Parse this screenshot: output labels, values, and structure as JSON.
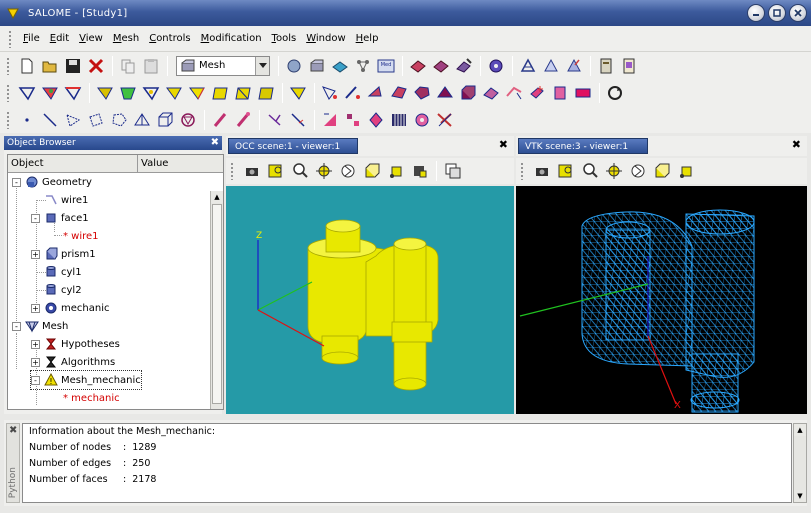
{
  "window": {
    "title": "SALOME - [Study1]"
  },
  "menu": [
    {
      "label": "File",
      "mnemonic": "F",
      "rest": "ile"
    },
    {
      "label": "Edit",
      "mnemonic": "E",
      "rest": "dit"
    },
    {
      "label": "View",
      "mnemonic": "V",
      "rest": "iew"
    },
    {
      "label": "Mesh",
      "mnemonic": "M",
      "rest": "esh"
    },
    {
      "label": "Controls",
      "mnemonic": "C",
      "rest": "ontrols"
    },
    {
      "label": "Modification",
      "mnemonic": "M",
      "rest": "odification"
    },
    {
      "label": "Tools",
      "mnemonic": "T",
      "rest": "ools"
    },
    {
      "label": "Window",
      "mnemonic": "W",
      "rest": "indow"
    },
    {
      "label": "Help",
      "mnemonic": "H",
      "rest": "elp"
    }
  ],
  "module_combo": {
    "value": "Mesh"
  },
  "object_browser": {
    "title": "Object Browser",
    "col_object": "Object",
    "col_value": "Value",
    "items": [
      {
        "label": "Geometry",
        "icon": "geometry-icon",
        "depth": 0,
        "expander": "-"
      },
      {
        "label": "wire1",
        "icon": "wire-icon",
        "depth": 1,
        "expander": ""
      },
      {
        "label": "face1",
        "icon": "face-icon",
        "depth": 1,
        "expander": "-"
      },
      {
        "label": "* wire1",
        "icon": "",
        "depth": 2,
        "expander": "",
        "red": true
      },
      {
        "label": "prism1",
        "icon": "prism-icon",
        "depth": 1,
        "expander": "+"
      },
      {
        "label": "cyl1",
        "icon": "cylinder-icon",
        "depth": 1,
        "expander": ""
      },
      {
        "label": "cyl2",
        "icon": "cylinder-icon",
        "depth": 1,
        "expander": ""
      },
      {
        "label": "mechanic",
        "icon": "compound-icon",
        "depth": 1,
        "expander": "+"
      },
      {
        "label": "Mesh",
        "icon": "mesh-module-icon",
        "depth": 0,
        "expander": "-"
      },
      {
        "label": "Hypotheses",
        "icon": "hypotheses-icon",
        "depth": 1,
        "expander": "+"
      },
      {
        "label": "Algorithms",
        "icon": "algorithms-icon",
        "depth": 1,
        "expander": "+"
      },
      {
        "label": "Mesh_mechanic",
        "icon": "mesh-warning-icon",
        "depth": 1,
        "expander": "-",
        "selected": true
      },
      {
        "label": "* mechanic",
        "icon": "",
        "depth": 2,
        "expander": "",
        "red": true
      }
    ]
  },
  "occ_viewer": {
    "tab": "OCC scene:1 - viewer:1",
    "background": "#259aa7",
    "shape_color": "#e8e800"
  },
  "vtk_viewer": {
    "tab": "VTK scene:3 - viewer:1",
    "background": "#000000",
    "mesh_color": "#2aa8ff"
  },
  "axis_labels": {
    "z": "Z",
    "x": "X"
  },
  "console": {
    "label": "Python",
    "heading": "Information about the Mesh_mechanic:",
    "rows": [
      {
        "label": "Number of nodes",
        "value": ":  1289"
      },
      {
        "label": "Number of edges",
        "value": ":  250"
      },
      {
        "label": "Number of faces",
        "value": ":  2178"
      }
    ]
  }
}
